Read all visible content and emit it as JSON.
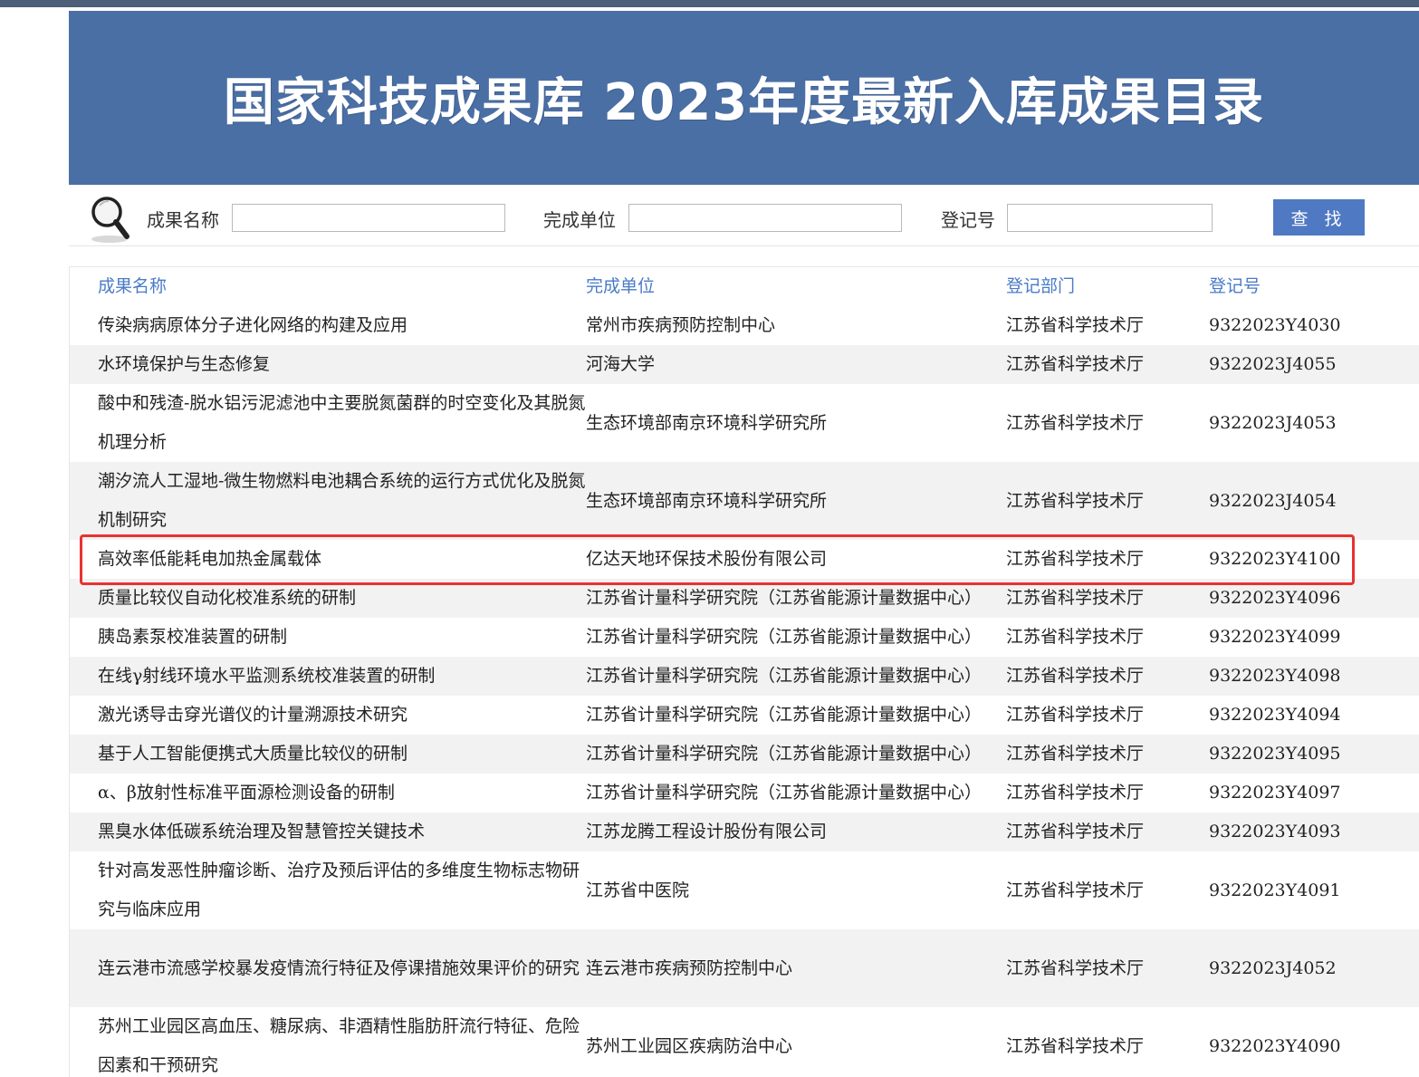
{
  "banner": {
    "title": "国家科技成果库 2023年度最新入库成果目录"
  },
  "search": {
    "label_name": "成果名称",
    "label_unit": "完成单位",
    "label_reg": "登记号",
    "button": "查 找"
  },
  "table": {
    "headers": [
      "成果名称",
      "完成单位",
      "登记部门",
      "登记号"
    ],
    "rows": [
      [
        "传染病病原体分子进化网络的构建及应用",
        "常州市疾病预防控制中心",
        "江苏省科学技术厅",
        "9322023Y4030"
      ],
      [
        "水环境保护与生态修复",
        "河海大学",
        "江苏省科学技术厅",
        "9322023J4055"
      ],
      [
        "酸中和残渣-脱水铝污泥滤池中主要脱氮菌群的时空变化及其脱氮机理分析",
        "生态环境部南京环境科学研究所",
        "江苏省科学技术厅",
        "9322023J4053"
      ],
      [
        "潮汐流人工湿地-微生物燃料电池耦合系统的运行方式优化及脱氮机制研究",
        "生态环境部南京环境科学研究所",
        "江苏省科学技术厅",
        "9322023J4054"
      ],
      [
        "高效率低能耗电加热金属载体",
        "亿达天地环保技术股份有限公司",
        "江苏省科学技术厅",
        "9322023Y4100"
      ],
      [
        "质量比较仪自动化校准系统的研制",
        "江苏省计量科学研究院（江苏省能源计量数据中心）",
        "江苏省科学技术厅",
        "9322023Y4096"
      ],
      [
        "胰岛素泵校准装置的研制",
        "江苏省计量科学研究院（江苏省能源计量数据中心）",
        "江苏省科学技术厅",
        "9322023Y4099"
      ],
      [
        "在线γ射线环境水平监测系统校准装置的研制",
        "江苏省计量科学研究院（江苏省能源计量数据中心）",
        "江苏省科学技术厅",
        "9322023Y4098"
      ],
      [
        "激光诱导击穿光谱仪的计量溯源技术研究",
        "江苏省计量科学研究院（江苏省能源计量数据中心）",
        "江苏省科学技术厅",
        "9322023Y4094"
      ],
      [
        "基于人工智能便携式大质量比较仪的研制",
        "江苏省计量科学研究院（江苏省能源计量数据中心）",
        "江苏省科学技术厅",
        "9322023Y4095"
      ],
      [
        "α、β放射性标准平面源检测设备的研制",
        "江苏省计量科学研究院（江苏省能源计量数据中心）",
        "江苏省科学技术厅",
        "9322023Y4097"
      ],
      [
        "黑臭水体低碳系统治理及智慧管控关键技术",
        "江苏龙腾工程设计股份有限公司",
        "江苏省科学技术厅",
        "9322023Y4093"
      ],
      [
        "针对高发恶性肿瘤诊断、治疗及预后评估的多维度生物标志物研究与临床应用",
        "江苏省中医院",
        "江苏省科学技术厅",
        "9322023Y4091"
      ],
      [
        "连云港市流感学校暴发疫情流行特征及停课措施效果评价的研究",
        "连云港市疾病预防控制中心",
        "江苏省科学技术厅",
        "9322023J4052"
      ],
      [
        "苏州工业园区高血压、糖尿病、非酒精性脂肪肝流行特征、危险因素和干预研究",
        "苏州工业园区疾病防治中心",
        "江苏省科学技术厅",
        "9322023Y4090"
      ]
    ],
    "row_heights": [
      "single",
      "single",
      "double",
      "double",
      "single",
      "single",
      "single",
      "single",
      "single",
      "single",
      "single",
      "single",
      "double",
      "double",
      "double"
    ]
  },
  "colors": {
    "banner": "#4a6fa5",
    "header_text": "#4a7bc7",
    "button": "#4f79c3",
    "highlight": "#e8322f"
  }
}
